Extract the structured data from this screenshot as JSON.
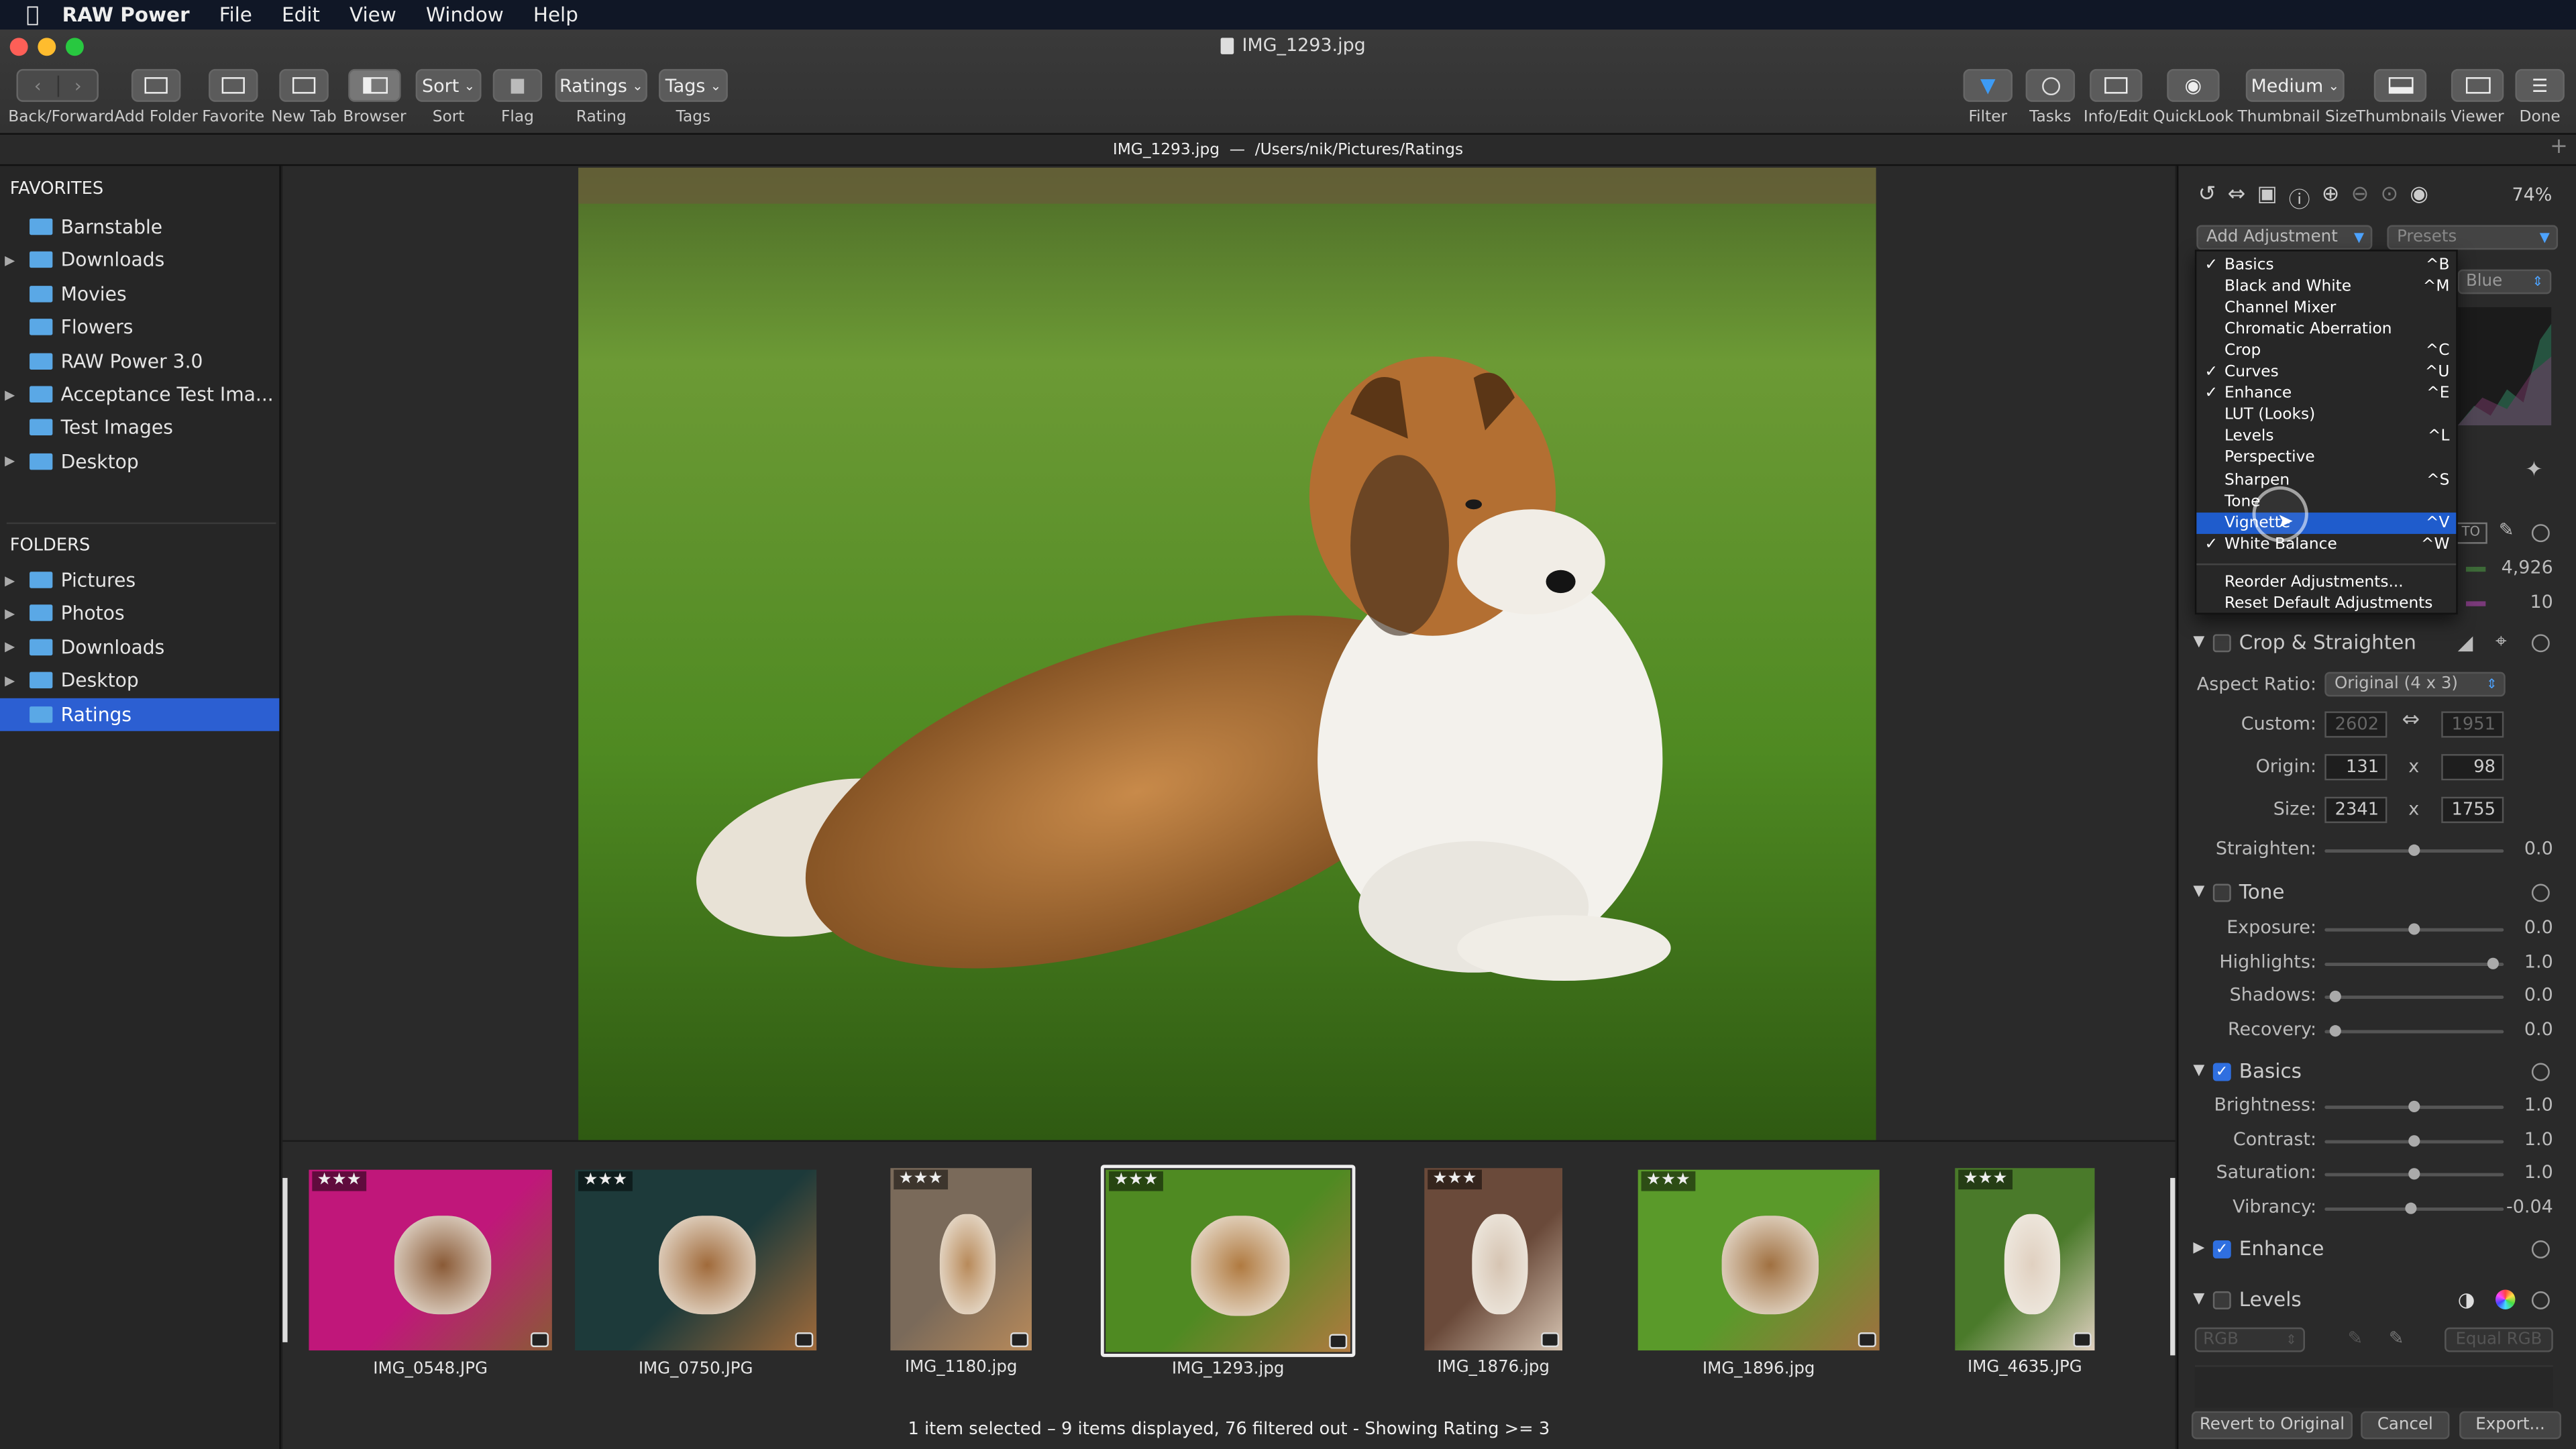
{
  "menubar": {
    "app": "RAW Power",
    "items": [
      "File",
      "Edit",
      "View",
      "Window",
      "Help"
    ]
  },
  "window": {
    "title": "IMG_1293.jpg",
    "path_title": "IMG_1293.jpg",
    "path_dash": "—",
    "path": "/Users/nik/Pictures/Ratings"
  },
  "toolbar": {
    "left": [
      {
        "name": "back-forward",
        "label": "Back/Forward"
      },
      {
        "name": "add-folder",
        "label": "Add Folder"
      },
      {
        "name": "favorite",
        "label": "Favorite"
      },
      {
        "name": "new-tab",
        "label": "New Tab"
      },
      {
        "name": "browser",
        "label": "Browser"
      }
    ],
    "sort": {
      "button": "Sort",
      "label": "Sort"
    },
    "flag": {
      "label": "Flag"
    },
    "rating": {
      "button": "Ratings",
      "label": "Rating"
    },
    "tags": {
      "button": "Tags",
      "label": "Tags"
    },
    "right": {
      "filter": "Filter",
      "tasks": "Tasks",
      "info": "Info/Edit",
      "quicklook": "QuickLook",
      "thumbsize_button": "Medium",
      "thumbsize": "Thumbnail Size",
      "thumbnails": "Thumbnails",
      "viewer": "Viewer",
      "done": "Done"
    }
  },
  "sidebar": {
    "favorites_header": "FAVORITES",
    "favorites": [
      {
        "label": "Barnstable",
        "expand": false
      },
      {
        "label": "Downloads",
        "expand": true
      },
      {
        "label": "Movies",
        "expand": false
      },
      {
        "label": "Flowers",
        "expand": false
      },
      {
        "label": "RAW Power 3.0",
        "expand": false
      },
      {
        "label": "Acceptance Test Ima...",
        "expand": true
      },
      {
        "label": "Test Images",
        "expand": false
      },
      {
        "label": "Desktop",
        "expand": true
      }
    ],
    "folders_header": "FOLDERS",
    "folders": [
      {
        "label": "Pictures",
        "expand": true
      },
      {
        "label": "Photos",
        "expand": true
      },
      {
        "label": "Downloads",
        "expand": true
      },
      {
        "label": "Desktop",
        "expand": true
      },
      {
        "label": "Ratings",
        "expand": false,
        "selected": true
      }
    ]
  },
  "filmstrip": {
    "thumbs": [
      {
        "name": "IMG_0548.JPG",
        "stars": "★★★"
      },
      {
        "name": "IMG_0750.JPG",
        "stars": "★★★"
      },
      {
        "name": "IMG_1180.jpg",
        "stars": "★★★"
      },
      {
        "name": "IMG_1293.jpg",
        "stars": "★★★",
        "selected": true
      },
      {
        "name": "IMG_1876.jpg",
        "stars": "★★★"
      },
      {
        "name": "IMG_1896.jpg",
        "stars": "★★★"
      },
      {
        "name": "IMG_4635.JPG",
        "stars": "★★★"
      }
    ],
    "status": "1 item selected – 9 items displayed, 76 filtered out - Showing Rating >= 3"
  },
  "panel": {
    "zoom": "74%",
    "add_adjustment": "Add Adjustment",
    "presets": "Presets",
    "channel": "Blue",
    "wb_values": [
      "4,926",
      "10"
    ],
    "auto_label": "TO",
    "crop": {
      "title": "Crop & Straighten",
      "aspect_label": "Aspect Ratio:",
      "aspect_value": "Original (4 x 3)",
      "custom_label": "Custom:",
      "custom_w": "2602",
      "custom_h": "1951",
      "origin_label": "Origin:",
      "origin_x": "131",
      "origin_y": "98",
      "size_label": "Size:",
      "size_w": "2341",
      "size_h": "1755",
      "times": "x",
      "straighten_label": "Straighten:",
      "straighten_value": "0.0",
      "straighten_pos": 0.5
    },
    "tone": {
      "title": "Tone",
      "rows": [
        {
          "label": "Exposure:",
          "value": "0.0",
          "pos": 0.5
        },
        {
          "label": "Highlights:",
          "value": "1.0",
          "pos": 0.97
        },
        {
          "label": "Shadows:",
          "value": "0.0",
          "pos": 0.03
        },
        {
          "label": "Recovery:",
          "value": "0.0",
          "pos": 0.03
        }
      ]
    },
    "basics": {
      "title": "Basics",
      "rows": [
        {
          "label": "Brightness:",
          "value": "1.0",
          "pos": 0.5
        },
        {
          "label": "Contrast:",
          "value": "1.0",
          "pos": 0.5
        },
        {
          "label": "Saturation:",
          "value": "1.0",
          "pos": 0.5
        },
        {
          "label": "Vibrancy:",
          "value": "-0.04",
          "pos": 0.48
        }
      ]
    },
    "enhance": {
      "title": "Enhance"
    },
    "levels": {
      "title": "Levels",
      "channel": "RGB",
      "equal": "Equal RGB"
    },
    "buttons": {
      "revert": "Revert to Original",
      "cancel": "Cancel",
      "export": "Export..."
    }
  },
  "menu": {
    "items": [
      {
        "label": "Basics",
        "check": "✓",
        "shortcut": "^B"
      },
      {
        "label": "Black and White",
        "check": "",
        "shortcut": "^M"
      },
      {
        "label": "Channel Mixer",
        "check": "",
        "shortcut": ""
      },
      {
        "label": "Chromatic Aberration",
        "check": "",
        "shortcut": ""
      },
      {
        "label": "Crop",
        "check": "",
        "shortcut": "^C"
      },
      {
        "label": "Curves",
        "check": "✓",
        "shortcut": "^U"
      },
      {
        "label": "Enhance",
        "check": "✓",
        "shortcut": "^E"
      },
      {
        "label": "LUT (Looks)",
        "check": "",
        "shortcut": ""
      },
      {
        "label": "Levels",
        "check": "",
        "shortcut": "^L"
      },
      {
        "label": "Perspective",
        "check": "",
        "shortcut": ""
      },
      {
        "label": "Sharpen",
        "check": "",
        "shortcut": "^S"
      },
      {
        "label": "Tone",
        "check": "",
        "shortcut": ""
      },
      {
        "label": "Vignette",
        "check": "",
        "shortcut": "^V",
        "highlight": true
      },
      {
        "label": "White Balance",
        "check": "✓",
        "shortcut": "^W"
      }
    ],
    "reorder": "Reorder Adjustments...",
    "reset": "Reset Default Adjustments"
  },
  "colors": {
    "accent": "#2c5fd2",
    "folder": "#5aa8e6",
    "menu_highlight": "#1f5ccc"
  }
}
